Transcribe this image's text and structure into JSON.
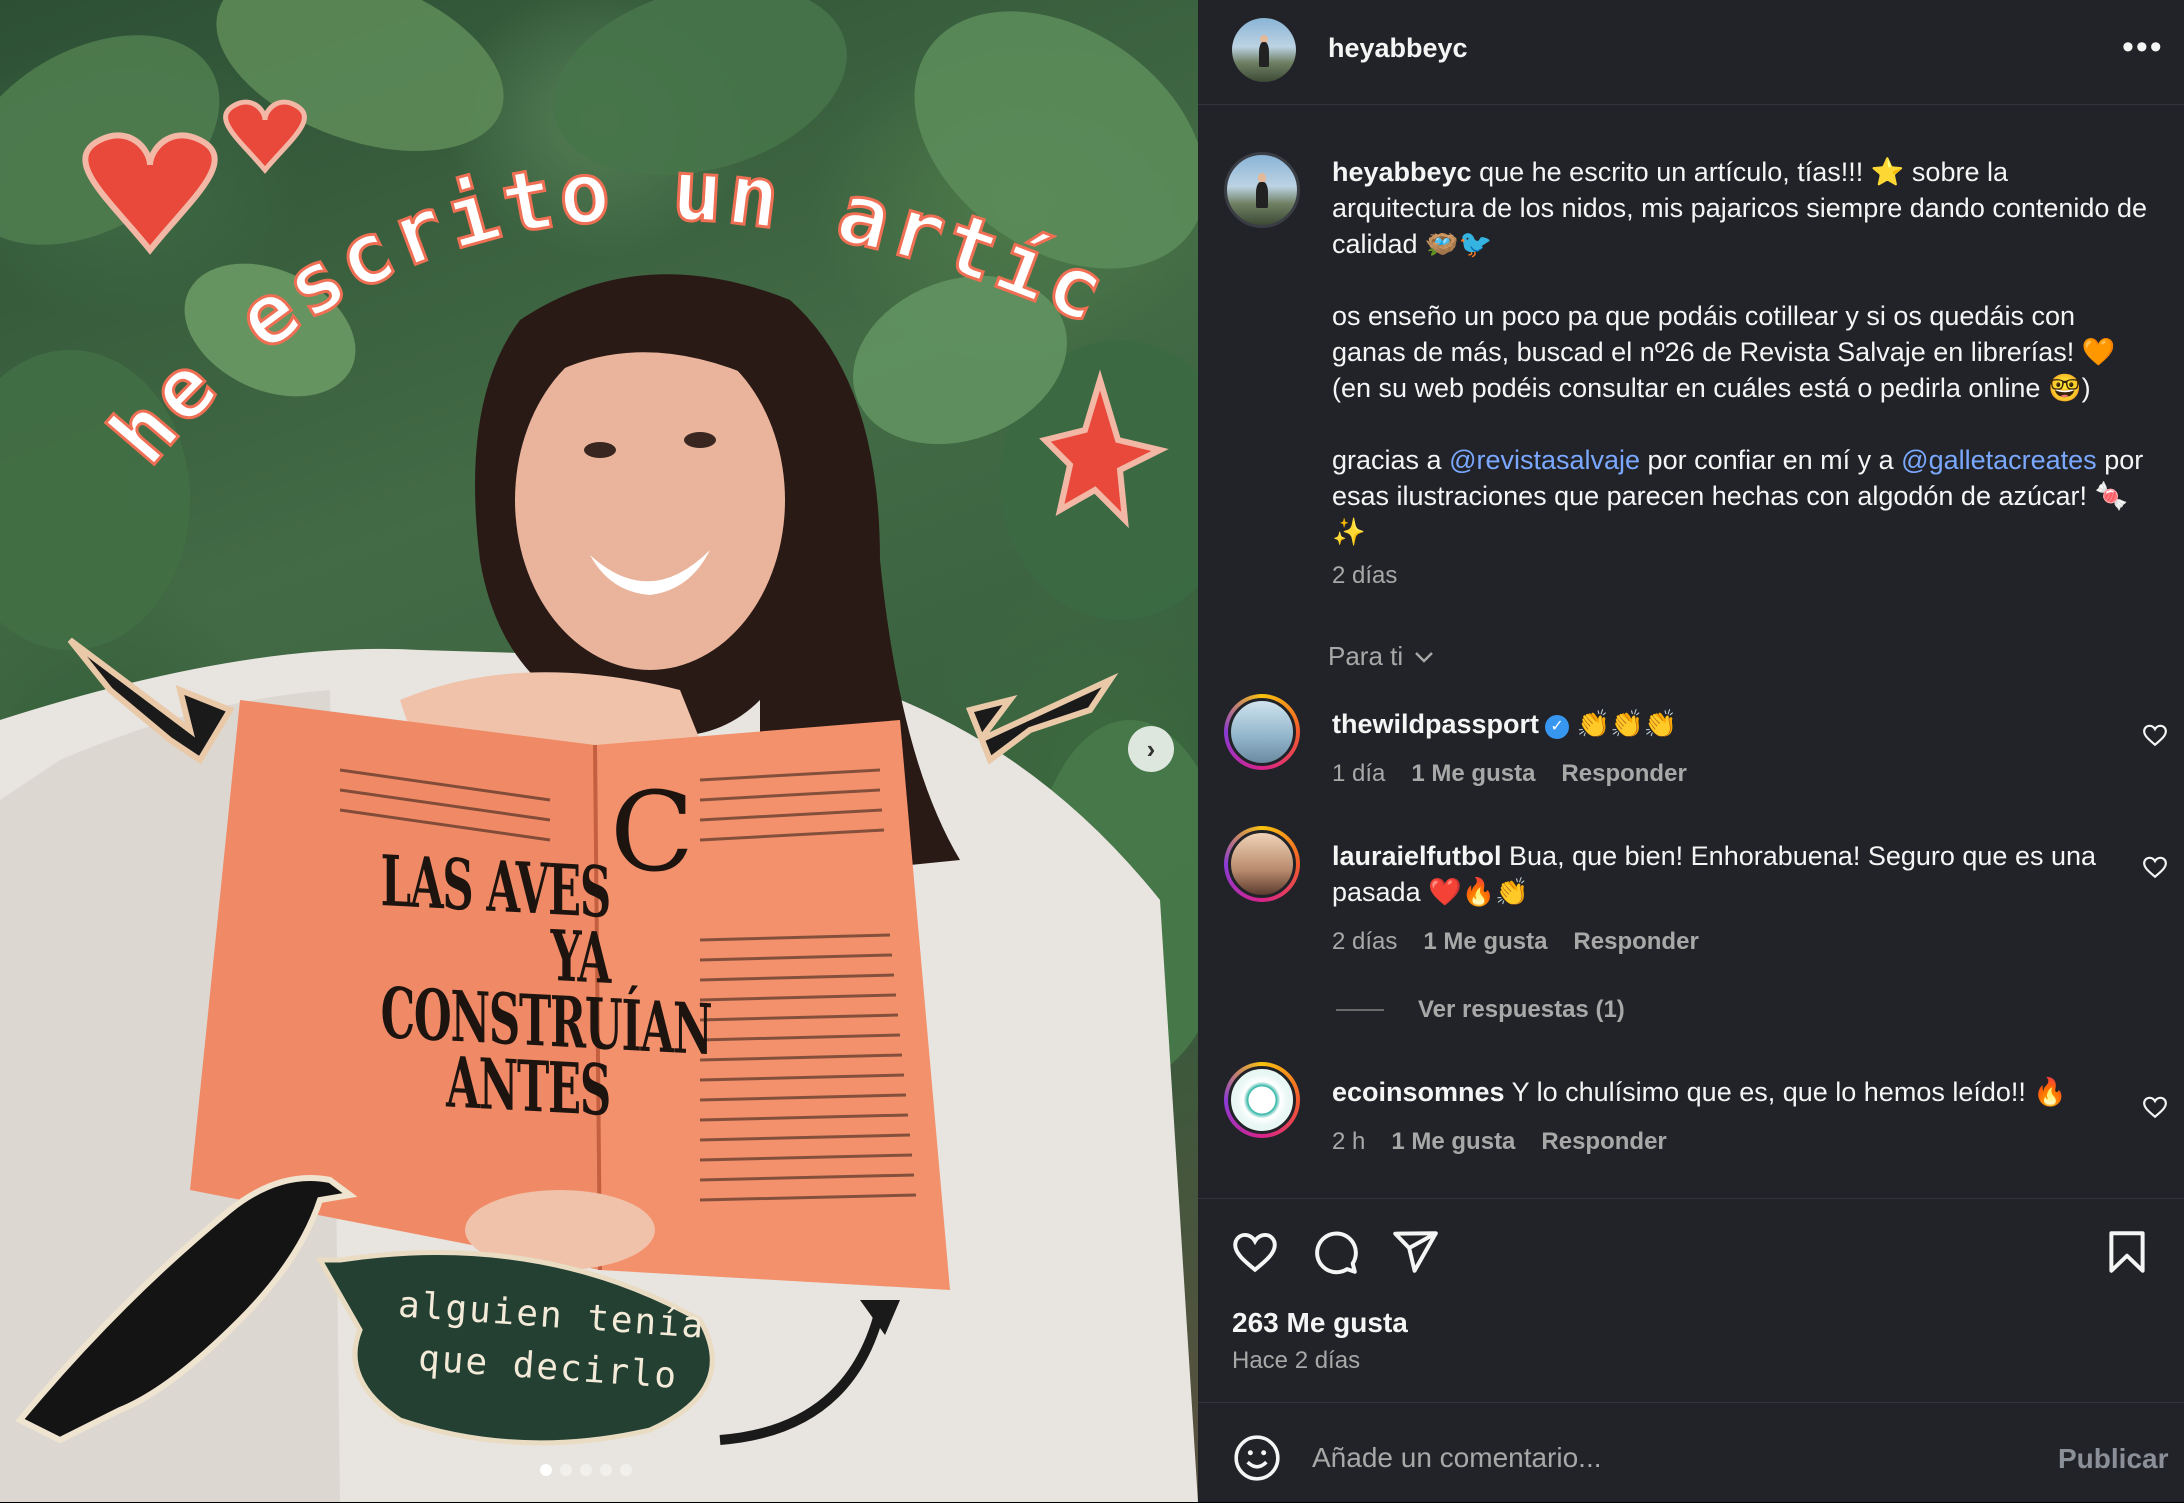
{
  "media": {
    "overlay_title": "he escrito un artículo!!!",
    "bubble_text": [
      "alguien tenía",
      "que decirlo"
    ],
    "book_headline": [
      "LAS AVES",
      "YA CONSTRUÍAN",
      "ANTES"
    ],
    "next_icon": "chevron-right-icon",
    "carousel_count": 5,
    "carousel_active": 0
  },
  "header": {
    "username": "heyabbeyc",
    "more_icon": "more-horizontal-icon"
  },
  "caption": {
    "username": "heyabbeyc",
    "p1": "que he escrito un artículo, tías!!! ⭐ sobre la arquitectura de los nidos, mis pajaricos siempre dando contenido de calidad 🪺🐦",
    "p2": "os enseño un poco pa que podáis cotillear y si os quedáis con ganas de más, buscad el nº26 de Revista Salvaje en librerías! 🧡 (en su web podéis consultar en cuáles está o pedirla online 🤓)",
    "p3_a": "gracias a ",
    "mention1": "@revistasalvaje",
    "p3_b": " por confiar en mí y a ",
    "mention2": "@galletacreates",
    "p3_c": " por esas ilustraciones que parecen hechas con algodón de azúcar! 🍬✨",
    "time": "2 días"
  },
  "filter": {
    "label": "Para ti",
    "icon": "chevron-down-icon"
  },
  "comments": [
    {
      "user": "thewildpassport",
      "verified": true,
      "text": "👏👏👏",
      "time": "1 día",
      "likes": "1 Me gusta",
      "reply": "Responder"
    },
    {
      "user": "lauraielfutbol",
      "verified": false,
      "text": "Bua, que bien! Enhorabuena! Seguro que es una pasada ❤️🔥👏",
      "time": "2 días",
      "likes": "1 Me gusta",
      "reply": "Responder"
    },
    {
      "user": "ecoinsomnes",
      "verified": false,
      "text": "Y lo chulísimo que es, que lo hemos leído!! 🔥",
      "time": "2 h",
      "likes": "1 Me gusta",
      "reply": "Responder"
    }
  ],
  "view_replies": "Ver respuestas (1)",
  "actions": {
    "like_icon": "heart-icon",
    "comment_icon": "comment-icon",
    "share_icon": "send-icon",
    "save_icon": "bookmark-icon",
    "likes": "263 Me gusta",
    "ago": "Hace 2 días"
  },
  "composer": {
    "emoji_icon": "emoji-icon",
    "placeholder": "Añade un comentario...",
    "publish": "Publicar"
  }
}
